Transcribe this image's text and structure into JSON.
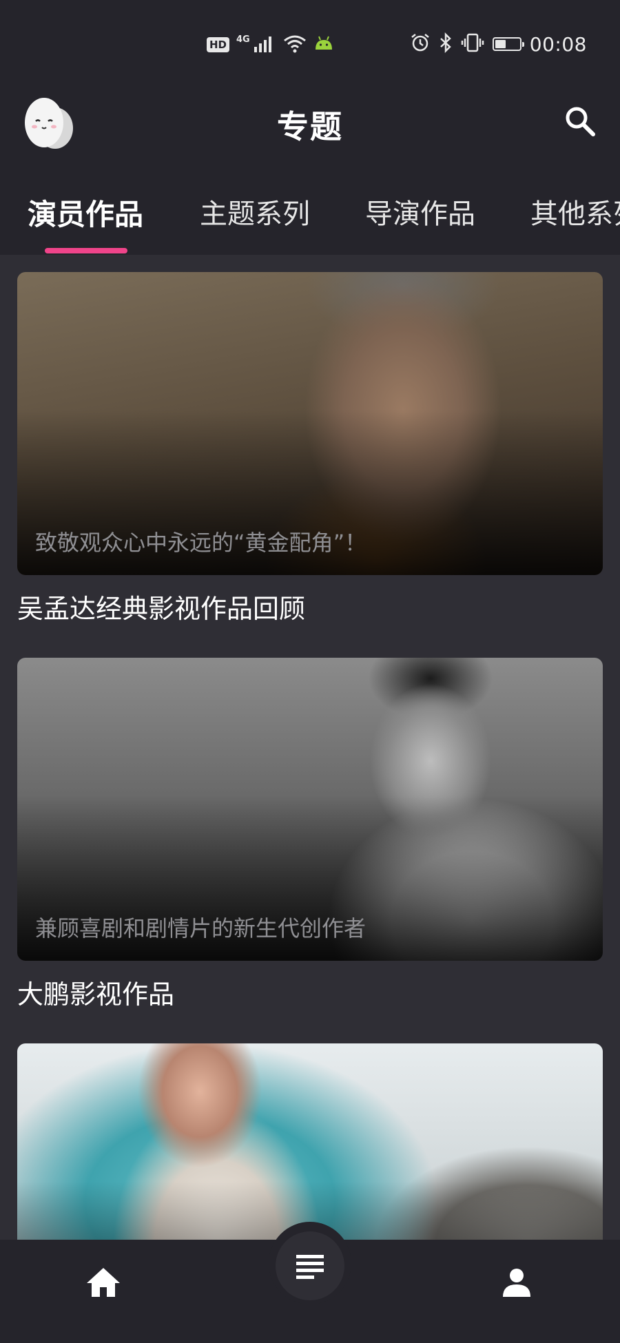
{
  "status_bar": {
    "hd": "HD",
    "network": "4G",
    "time": "00:08",
    "battery_level": 0.45
  },
  "header": {
    "title": "专题",
    "logo_icon": "egg-mascot-icon",
    "search_icon": "search-icon"
  },
  "tabs": [
    {
      "label": "演员作品",
      "active": true
    },
    {
      "label": "主题系列",
      "active": false
    },
    {
      "label": "导演作品",
      "active": false
    },
    {
      "label": "其他系列",
      "active": false
    }
  ],
  "colors": {
    "accent": "#f0448a",
    "background": "#2f2e35",
    "bar": "#25242b"
  },
  "cards": [
    {
      "subtitle": "致敬观众心中永远的“黄金配角”！",
      "title": "吴孟达经典影视作品回顾"
    },
    {
      "subtitle": "兼顾喜剧和剧情片的新生代创作者",
      "title": "大鹏影视作品"
    },
    {
      "subtitle": "",
      "title": ""
    }
  ],
  "bottom_nav": [
    {
      "icon": "home-icon"
    },
    {
      "icon": "list-icon"
    },
    {
      "icon": "user-icon"
    }
  ]
}
